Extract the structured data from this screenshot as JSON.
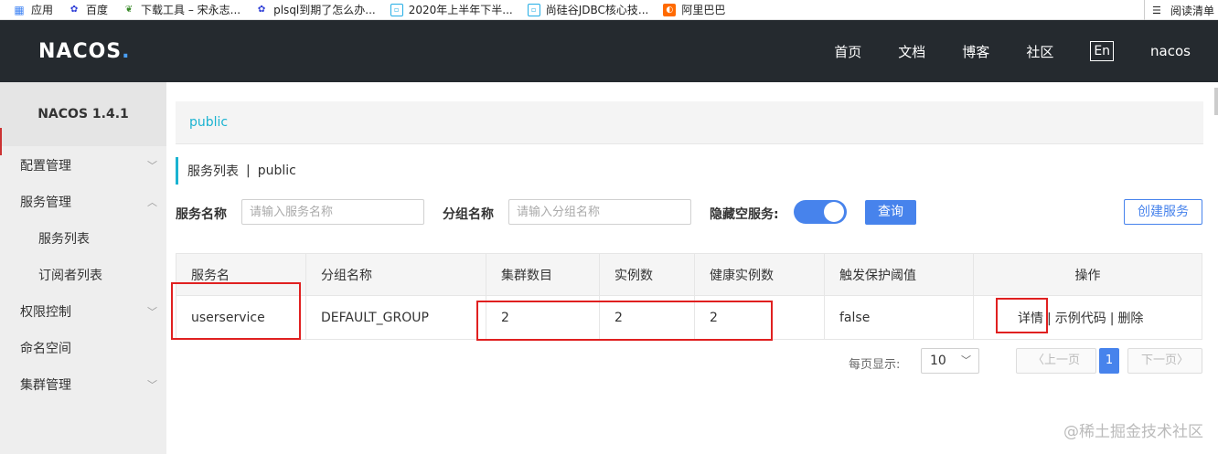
{
  "bookmarks": {
    "apps": "应用",
    "items": [
      "百度",
      "下载工具 – 宋永志...",
      "plsql到期了怎么办...",
      "2020年上半年下半...",
      "尚硅谷JDBC核心技...",
      "阿里巴巴"
    ],
    "reading_list": "阅读清单"
  },
  "header": {
    "logo": "NACOS",
    "logo_dot": ".",
    "nav": [
      "首页",
      "文档",
      "博客",
      "社区"
    ],
    "lang": "En",
    "user": "nacos"
  },
  "sidebar": {
    "title": "NACOS 1.4.1",
    "items": [
      {
        "label": "配置管理"
      },
      {
        "label": "服务管理"
      },
      {
        "label": "服务列表"
      },
      {
        "label": "订阅者列表"
      },
      {
        "label": "权限控制"
      },
      {
        "label": "命名空间"
      },
      {
        "label": "集群管理"
      }
    ]
  },
  "namespace": "public",
  "page_head": {
    "title": "服务列表",
    "sep": "|",
    "ns": "public"
  },
  "filters": {
    "service_label": "服务名称",
    "service_placeholder": "请输入服务名称",
    "group_label": "分组名称",
    "group_placeholder": "请输入分组名称",
    "hide_empty_label": "隐藏空服务:",
    "hide_empty_on": true,
    "query": "查询",
    "create": "创建服务"
  },
  "table": {
    "headers": [
      "服务名",
      "分组名称",
      "集群数目",
      "实例数",
      "健康实例数",
      "触发保护阈值",
      "操作"
    ],
    "rows": [
      {
        "name": "userservice",
        "group": "DEFAULT_GROUP",
        "clusters": "2",
        "instances": "2",
        "healthy": "2",
        "threshold": "false",
        "ops": [
          "详情",
          "示例代码",
          "删除"
        ],
        "ops_sep": "|"
      }
    ]
  },
  "pager": {
    "label": "每页显示:",
    "page_size": "10",
    "prev": "上一页",
    "current": "1",
    "next": "下一页"
  },
  "watermark": "@稀土掘金技术社区",
  "colors": {
    "accent": "#4783ec",
    "teal": "#1ab3d1",
    "header_bg": "#252a2f",
    "highlight": "#e02020"
  }
}
